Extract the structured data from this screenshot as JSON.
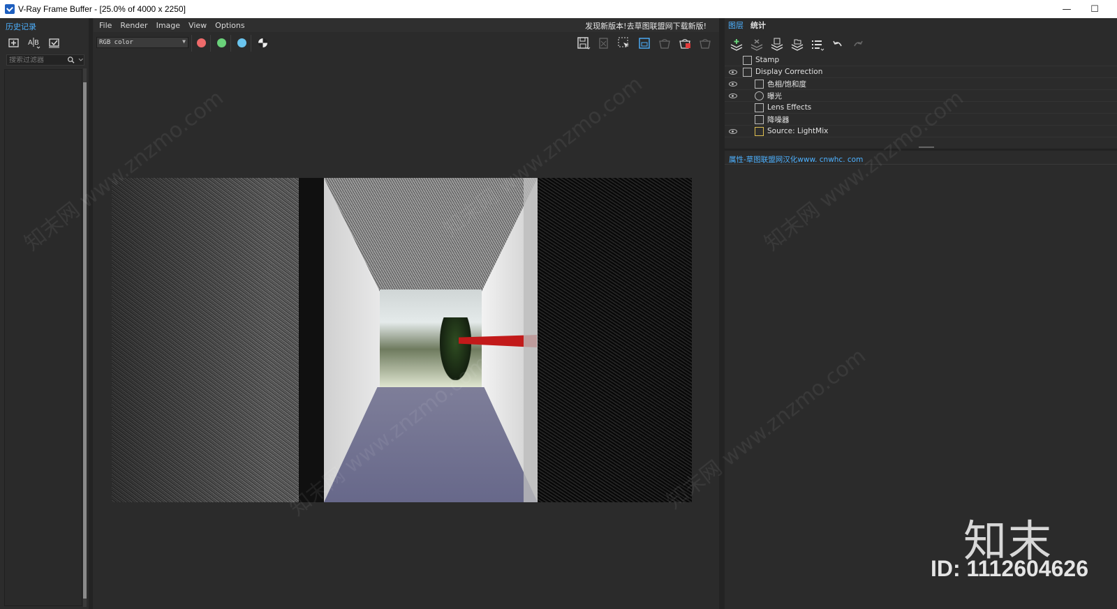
{
  "window": {
    "title": "V-Ray Frame Buffer - [25.0% of 4000 x 2250]",
    "minimize_glyph": "—",
    "maximize_glyph": "☐"
  },
  "history_panel": {
    "tab_label": "历史记录",
    "search_placeholder": "搜索过滤器",
    "tools": [
      "save-to-history-icon",
      "ab-compare-icon",
      "history-options-icon"
    ]
  },
  "menu": {
    "items": [
      "File",
      "Render",
      "Image",
      "View",
      "Options"
    ],
    "update_notice": "发现新版本!去草图联盟网下载新版!"
  },
  "toolbar": {
    "channel_value": "RGB color",
    "color_dots": {
      "red": "#ee6a6a",
      "green": "#6ad27a",
      "blue": "#6ac4ee"
    },
    "right_tools": [
      "save-image-icon",
      "clear-image-icon",
      "region-render-icon",
      "track-mouse-icon",
      "render-last-icon",
      "stop-render-icon",
      "render-icon"
    ]
  },
  "layers_panel": {
    "tabs": [
      "图层",
      "统计"
    ],
    "tools": [
      "create-layer-icon",
      "delete-layer-icon",
      "save-layer-icon",
      "load-layer-icon",
      "layer-list-icon",
      "undo-icon",
      "redo-icon"
    ],
    "layers": [
      {
        "name": "Stamp",
        "visible": false,
        "indent": 0
      },
      {
        "name": "Display Correction",
        "visible": true,
        "indent": 0
      },
      {
        "name": "色相/饱和度",
        "visible": true,
        "indent": 1
      },
      {
        "name": "曝光",
        "visible": true,
        "indent": 1
      },
      {
        "name": "Lens Effects",
        "visible": false,
        "indent": 1
      },
      {
        "name": "降噪器",
        "visible": false,
        "indent": 1
      },
      {
        "name": "Source: LightMix",
        "visible": true,
        "indent": 1
      }
    ],
    "properties_label": "属性-草图联盟网汉化www. cnwhc. com"
  },
  "watermark": {
    "logo": "知末",
    "id": "ID: 1112604626",
    "diagonal": "知末网 www.znzmo.com"
  },
  "colors": {
    "accent": "#4db1ff",
    "panel_bg": "#2b2b2b"
  }
}
